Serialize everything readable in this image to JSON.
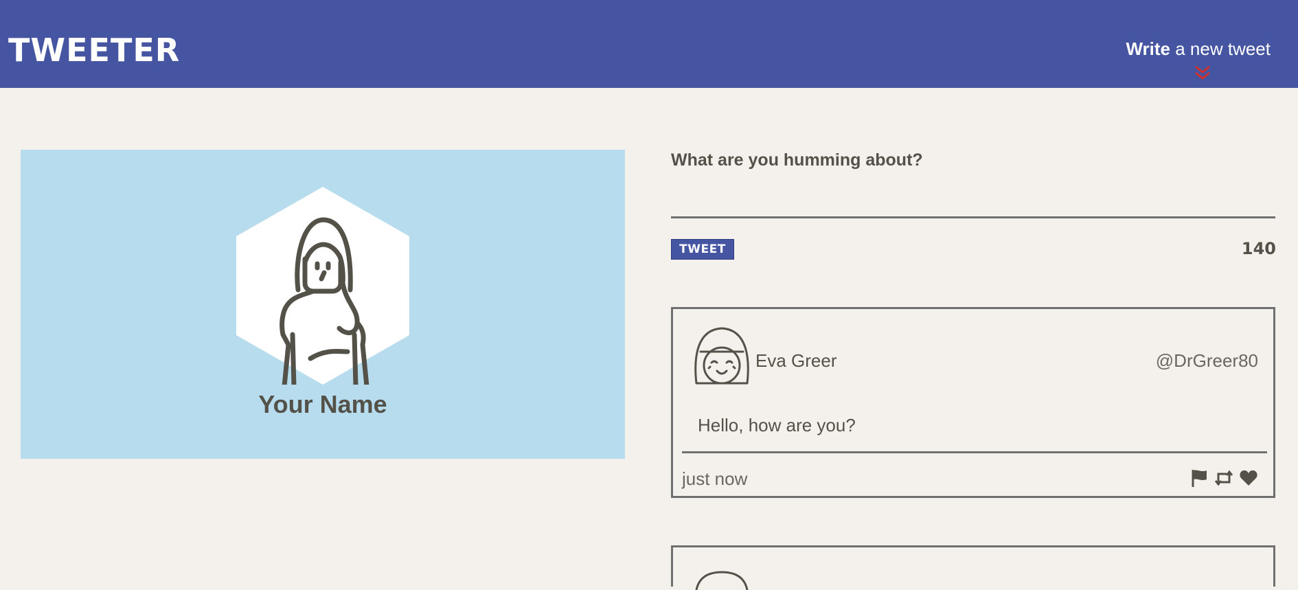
{
  "header": {
    "logo": "TWEETER",
    "compose_toggle_bold": "Write",
    "compose_toggle_rest": " a new tweet",
    "chevron_icon": "double-chevron-down-icon",
    "background_color": "#4655a2",
    "chevron_color": "#d0312d"
  },
  "profile": {
    "name": "Your Name",
    "background_color": "#b6dcee"
  },
  "compose": {
    "label": "What are you humming about?",
    "input_value": "",
    "button_label": "TWEET",
    "counter": "140"
  },
  "tweets": [
    {
      "name": "Eva Greer",
      "handle": "@DrGreer80",
      "body": "Hello, how are you?",
      "time": "just now",
      "actions": [
        "flag-icon",
        "retweet-icon",
        "heart-icon"
      ]
    }
  ]
}
